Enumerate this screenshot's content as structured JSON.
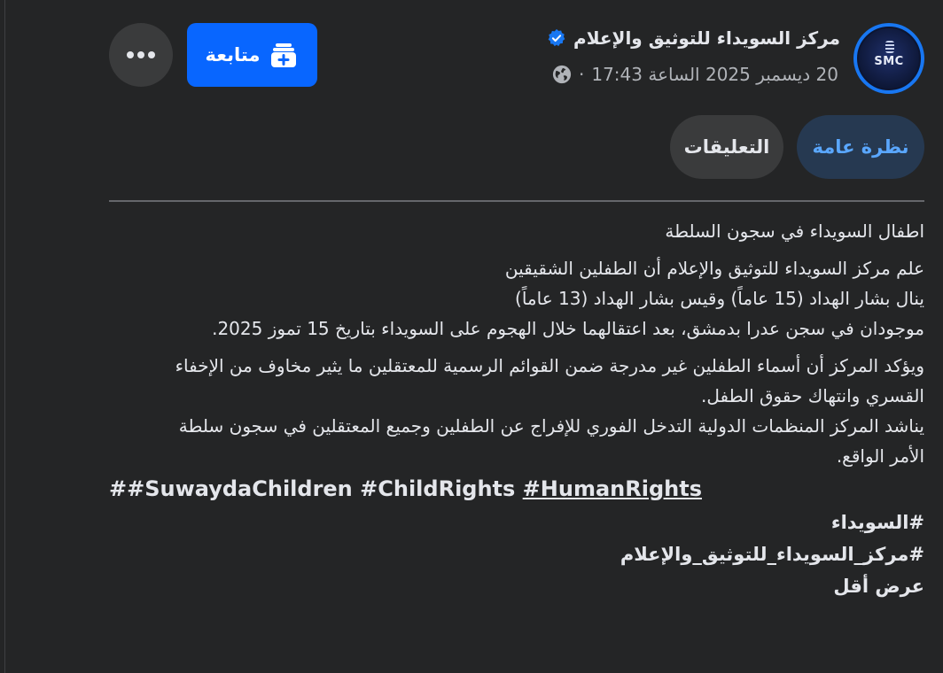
{
  "header": {
    "page_name": "مركز السويداء للتوثيق والإعلام",
    "avatar_text": "SMC",
    "timestamp": "20 ديسمبر 2025 الساعة 17:43",
    "separator": "·",
    "audience_icon": "globe-icon",
    "verified_icon": "verified-badge-icon"
  },
  "actions": {
    "follow_label": "متابعة",
    "follow_icon": "add-to-feed-icon",
    "more_icon": "more-options-icon"
  },
  "tabs": [
    {
      "label": "نظرة عامة",
      "active": true
    },
    {
      "label": "التعليقات",
      "active": false
    }
  ],
  "post": {
    "title": "اطفال السويداء في سجون السلطة",
    "para1": [
      "علم مركز السويداء للتوثيق والإعلام أن الطفلين الشقيقين",
      "ينال بشار الهداد (15 عاماً) وقيس بشار الهداد (13 عاماً)",
      "موجودان في سجن عدرا بدمشق، بعد اعتقالهما خلال الهجوم على السويداء بتاريخ 15 تموز 2025."
    ],
    "para2": [
      "ويؤكد المركز أن أسماء الطفلين غير مدرجة ضمن القوائم الرسمية للمعتقلين ما يثير مخاوف من الإخفاء",
      "القسري وانتهاك حقوق الطفل.",
      "يناشد المركز المنظمات الدولية التدخل الفوري للإفراج عن الطفلين وجميع المعتقلين في سجون سلطة",
      "الأمر الواقع."
    ],
    "hashtags_en": [
      "##SuwaydaChildren",
      "#ChildRights",
      "#HumanRights"
    ],
    "hashtags_ar": [
      "#السويداء",
      "#مركز_السويداء_للتوثيق_والإعلام"
    ],
    "show_less": "عرض أقل"
  },
  "colors": {
    "background": "#242526",
    "primary_blue": "#0866ff",
    "active_tab_bg": "#263951",
    "active_tab_text": "#5aa7ff",
    "secondary_text": "#b0b3b8"
  }
}
